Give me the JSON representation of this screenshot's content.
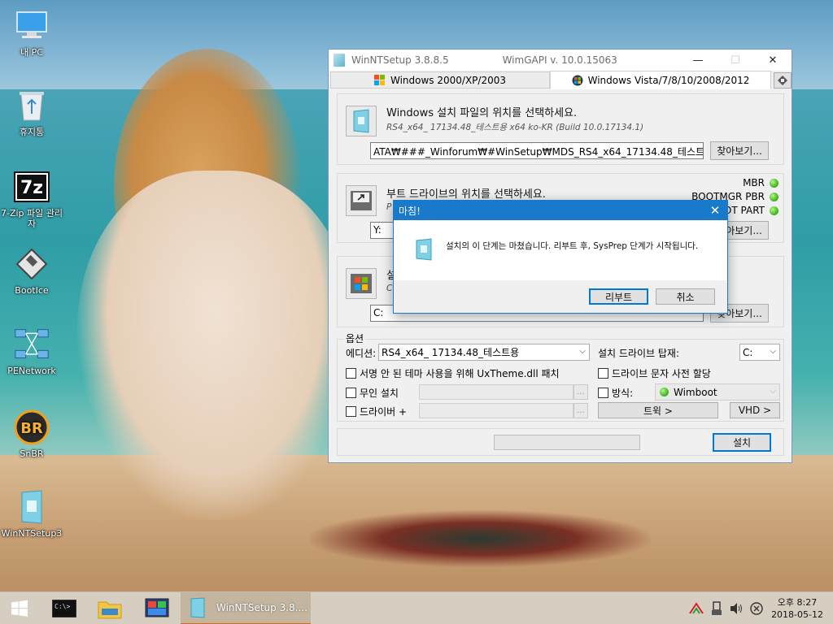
{
  "desktop": {
    "icons": [
      {
        "label": "내 PC"
      },
      {
        "label": "휴지통"
      },
      {
        "label": "7-Zip 파일 관리자"
      },
      {
        "label": "BootIce"
      },
      {
        "label": "PENetwork"
      },
      {
        "label": "SnBR"
      },
      {
        "label": "WinNTSetup3"
      }
    ]
  },
  "window": {
    "title": "WinNTSetup  3.8.8.5",
    "api": "WimGAPI  v.  10.0.15063",
    "tabs": [
      {
        "label": "Windows 2000/XP/2003"
      },
      {
        "label": "Windows Vista/7/8/10/2008/2012"
      }
    ],
    "source": {
      "title": "Windows 설치 파일의 위치를 선택하세요.",
      "subtitle": "RS4_x64_ 17134.48_테스트용 x64 ko-KR (Build 10.0.17134.1)",
      "path": "ATA₩###_Winforum₩#WinSetup₩MDS_RS4_x64_17134.48_테스트용.wim",
      "browse": "찾아보기..."
    },
    "boot": {
      "title": "부트 드라이브의 위치를 선택하세요.",
      "subtitle": "P",
      "value": "Y:",
      "browse": "찾아보기...",
      "status": [
        {
          "label": "MBR"
        },
        {
          "label": "BOOTMGR PBR"
        },
        {
          "label": "BOOT PART"
        }
      ],
      "status_color": "#4fbf2a"
    },
    "install": {
      "title": "설",
      "subtitle": "C",
      "value": "C:",
      "browse": "찾아보기..."
    },
    "options": {
      "group_label": "옵션",
      "edition_label": "에디션:",
      "edition_value": "RS4_x64_ 17134.48_테스트용",
      "mount_label": "설치 드라이브 탑재:",
      "mount_value": "C:",
      "uxtheme": "서명 안 된 테마 사용을 위해 UxTheme.dll 패치",
      "prealloc": "드라이브 문자 사전 할당",
      "unattended": "무인 설치",
      "mode_label": "방식:",
      "mode_value": "Wimboot",
      "drivers": "드라이버 +",
      "ellipsis": "...",
      "tweaks": "트윅 >",
      "vhd": "VHD >"
    },
    "setup_button": "설치"
  },
  "dialog": {
    "title": "마침!",
    "message": "설치의 이 단계는 마쳤습니다.  리부트 후, SysPrep 단계가 시작됩니다.",
    "reboot": "리부트",
    "cancel": "취소"
  },
  "taskbar": {
    "active_app": "WinNTSetup  3.8....",
    "clock_time": "오후 8:27",
    "clock_date": "2018-05-12"
  }
}
